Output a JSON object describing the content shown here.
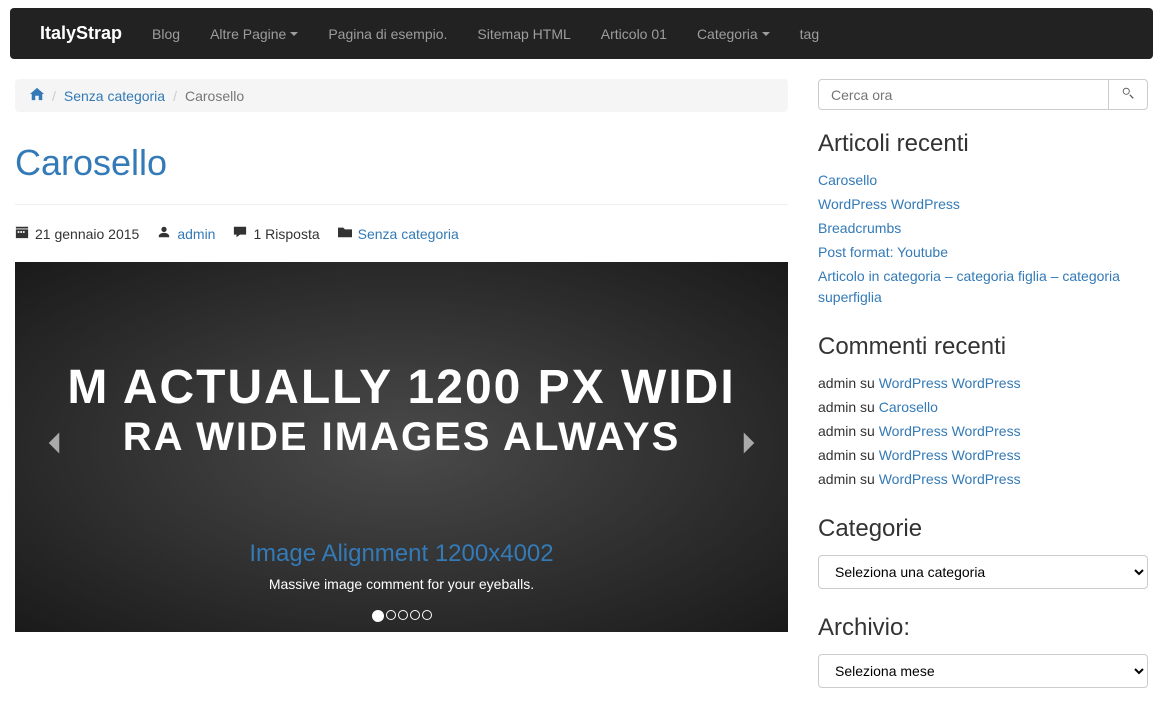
{
  "nav": {
    "brand": "ItalyStrap",
    "items": [
      {
        "label": "Blog",
        "dropdown": false
      },
      {
        "label": "Altre Pagine",
        "dropdown": true
      },
      {
        "label": "Pagina di esempio.",
        "dropdown": false
      },
      {
        "label": "Sitemap HTML",
        "dropdown": false
      },
      {
        "label": "Articolo 01",
        "dropdown": false
      },
      {
        "label": "Categoria",
        "dropdown": true
      },
      {
        "label": "tag",
        "dropdown": false
      }
    ]
  },
  "breadcrumb": {
    "category": "Senza categoria",
    "current": "Carosello"
  },
  "post": {
    "title": "Carosello",
    "date": "21 gennaio 2015",
    "author": "admin",
    "comments": "1 Risposta",
    "category": "Senza categoria"
  },
  "carousel": {
    "line1": "M ACTUALLY 1200 PX WIDI",
    "line2": "RA WIDE IMAGES ALWAYS",
    "caption_title": "Image Alignment 1200x4002",
    "caption_text": "Massive image comment for your eyeballs."
  },
  "search": {
    "placeholder": "Cerca ora"
  },
  "widgets": {
    "recent_posts": {
      "title": "Articoli recenti",
      "items": [
        "Carosello",
        "WordPress WordPress",
        "Breadcrumbs",
        "Post format: Youtube",
        "Articolo in categoria – categoria figlia – categoria superfiglia"
      ]
    },
    "recent_comments": {
      "title": "Commenti recenti",
      "on_text": "su",
      "items": [
        {
          "author": "admin",
          "post": "WordPress WordPress"
        },
        {
          "author": "admin",
          "post": "Carosello"
        },
        {
          "author": "admin",
          "post": "WordPress WordPress"
        },
        {
          "author": "admin",
          "post": "WordPress WordPress"
        },
        {
          "author": "admin",
          "post": "WordPress WordPress"
        }
      ]
    },
    "categories": {
      "title": "Categorie",
      "placeholder": "Seleziona una categoria"
    },
    "archive": {
      "title": "Archivio:",
      "placeholder": "Seleziona mese"
    }
  }
}
